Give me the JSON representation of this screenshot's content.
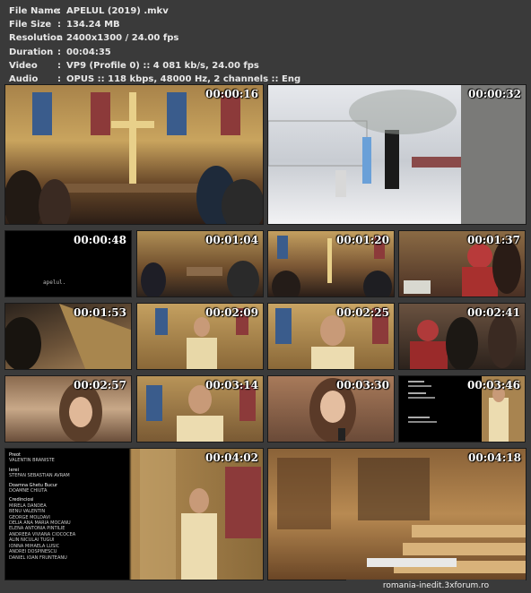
{
  "info": [
    {
      "key": "File Name",
      "value": "APELUL (2019) .mkv"
    },
    {
      "key": "File Size",
      "value": "134.24 MB"
    },
    {
      "key": "Resolution",
      "value": "2400x1300 / 24.00 fps"
    },
    {
      "key": "Duration",
      "value": "00:04:35"
    },
    {
      "key": "Video",
      "value": "VP9 (Profile 0) :: 4 081 kb/s, 24.00 fps"
    },
    {
      "key": "Audio",
      "value": "OPUS :: 118 kbps, 48000 Hz, 2 channels :: Eng"
    }
  ],
  "timestamps": [
    "00:00:16",
    "00:00:32",
    "00:00:48",
    "00:01:04",
    "00:01:20",
    "00:01:37",
    "00:01:53",
    "00:02:09",
    "00:02:25",
    "00:02:41",
    "00:02:57",
    "00:03:14",
    "00:03:30",
    "00:03:46",
    "00:04:02",
    "00:04:18"
  ],
  "black_frame_caption": "apelul.",
  "credits": [
    {
      "head": "Preot",
      "names": [
        "VALENTIN BRANISTE"
      ]
    },
    {
      "head": "Ierei",
      "names": [
        "STEFAN SEBASTIAN AVRAM"
      ]
    },
    {
      "head": "Doamna Ghetu Bucur",
      "names": [
        "DOAMNE CHIUTA"
      ]
    },
    {
      "head": "Credinciosi",
      "names": [
        "MIRELA DANDEA",
        "BENU VALENTIN",
        "GEORGE MOLDAVI",
        "DELIA ANA MARIA MOCANU",
        "ELENA ANTONIA PINTILIE",
        "ANDREEA VIVIANA CIOCOCEA",
        "ALIN NICULAI TUGUI",
        "IONNA MIHAELA LUSIC",
        "ANDREI DOSPINESCU",
        "DANIEL IOAN FRUNTEANU"
      ]
    }
  ],
  "footer": "romania-inedit.3xforum.ro"
}
